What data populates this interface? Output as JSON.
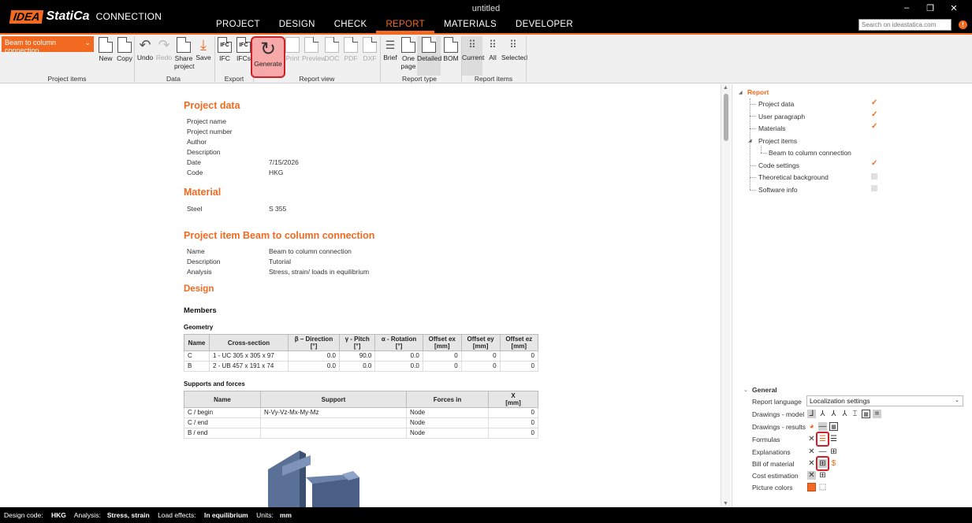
{
  "app": {
    "window_title": "untitled",
    "logo_idea": "IDEA",
    "logo_statica": "StatiCa",
    "product": "CONNECTION",
    "tabs": [
      "PROJECT",
      "DESIGN",
      "CHECK",
      "REPORT",
      "MATERIALS",
      "DEVELOPER"
    ],
    "active_tab": "REPORT",
    "search_placeholder": "Search on ideastatica.com",
    "alert": "!",
    "accent_color": "#f26a21",
    "highlight_color": "#cc2127"
  },
  "ribbon": {
    "project_item": "Beam to column connection",
    "buttons": {
      "new": "New",
      "copy": "Copy",
      "undo": "Undo",
      "redo": "Redo",
      "share": "Share\nproject",
      "save": "Save",
      "ifc": "IFC",
      "ifcs": "IFCs",
      "generate": "Generate",
      "print": "Print",
      "preview": "Preview",
      "doc": "DOC",
      "pdf": "PDF",
      "dxf": "DXF",
      "brief": "Brief",
      "onepage": "One\npage",
      "detailed": "Detailed",
      "bom": "BOM",
      "current": "Current",
      "all": "All",
      "selected": "Selected"
    },
    "groups": {
      "project_items": "Project items",
      "data": "Data",
      "export": "Export",
      "report_view": "Report view",
      "report_type": "Report type",
      "report_items": "Report items"
    }
  },
  "report": {
    "project_data": {
      "title": "Project data",
      "rows": [
        {
          "k": "Project name",
          "v": ""
        },
        {
          "k": "Project number",
          "v": ""
        },
        {
          "k": "Author",
          "v": ""
        },
        {
          "k": "Description",
          "v": ""
        },
        {
          "k": "Date",
          "v": "7/15/2026"
        },
        {
          "k": "Code",
          "v": "HKG"
        }
      ]
    },
    "material": {
      "title": "Material",
      "k": "Steel",
      "v": "S 355"
    },
    "project_item": {
      "title": "Project item Beam to column connection",
      "rows": [
        {
          "k": "Name",
          "v": "Beam to column connection"
        },
        {
          "k": "Description",
          "v": "Tutorial"
        },
        {
          "k": "Analysis",
          "v": "Stress, strain/ loads in equilibrium"
        }
      ]
    },
    "design_title": "Design",
    "members_title": "Members",
    "geometry_title": "Geometry",
    "geometry_headers": [
      {
        "t": "Name",
        "u": ""
      },
      {
        "t": "Cross-section",
        "u": ""
      },
      {
        "t": "β – Direction",
        "u": "[°]"
      },
      {
        "t": "γ - Pitch",
        "u": "[°]"
      },
      {
        "t": "α - Rotation",
        "u": "[°]"
      },
      {
        "t": "Offset ex",
        "u": "[mm]"
      },
      {
        "t": "Offset ey",
        "u": "[mm]"
      },
      {
        "t": "Offset ez",
        "u": "[mm]"
      }
    ],
    "geometry_rows": [
      [
        "C",
        "1 - UC 305 x 305 x 97",
        "0.0",
        "90.0",
        "0.0",
        "0",
        "0",
        "0"
      ],
      [
        "B",
        "2 - UB 457 x 191 x 74",
        "0.0",
        "0.0",
        "0.0",
        "0",
        "0",
        "0"
      ]
    ],
    "supports_title": "Supports and forces",
    "supports_headers": [
      {
        "t": "Name",
        "u": ""
      },
      {
        "t": "Support",
        "u": ""
      },
      {
        "t": "Forces in",
        "u": ""
      },
      {
        "t": "X",
        "u": "[mm]"
      }
    ],
    "supports_rows": [
      [
        "C / begin",
        "N-Vy-Vz-Mx-My-Mz",
        "Node",
        "0"
      ],
      [
        "C / end",
        "",
        "Node",
        "0"
      ],
      [
        "B / end",
        "",
        "Node",
        "0"
      ]
    ]
  },
  "tree": {
    "root": "Report",
    "items": [
      {
        "label": "Project data",
        "checked": true
      },
      {
        "label": "User paragraph",
        "checked": true
      },
      {
        "label": "Materials",
        "checked": true
      },
      {
        "label": "Project items",
        "checked": null
      },
      {
        "label": "Beam to column connection",
        "checked": null
      },
      {
        "label": "Code settings",
        "checked": true
      },
      {
        "label": "Theoretical background",
        "checked": false
      },
      {
        "label": "Software info",
        "checked": false
      }
    ]
  },
  "general": {
    "title": "General",
    "rows": {
      "report_language": "Report language",
      "drawings_model": "Drawings - model",
      "drawings_results": "Drawings - results",
      "formulas": "Formulas",
      "explanations": "Explanations",
      "bill_of_material": "Bill of material",
      "cost_estimation": "Cost estimation",
      "picture_colors": "Picture colors"
    },
    "language_value": "Localization settings"
  },
  "status": {
    "design_code_label": "Design code:",
    "design_code": "HKG",
    "analysis_label": "Analysis:",
    "analysis": "Stress, strain",
    "load_label": "Load effects:",
    "load": "In equilibrium",
    "units_label": "Units:",
    "units": "mm"
  }
}
